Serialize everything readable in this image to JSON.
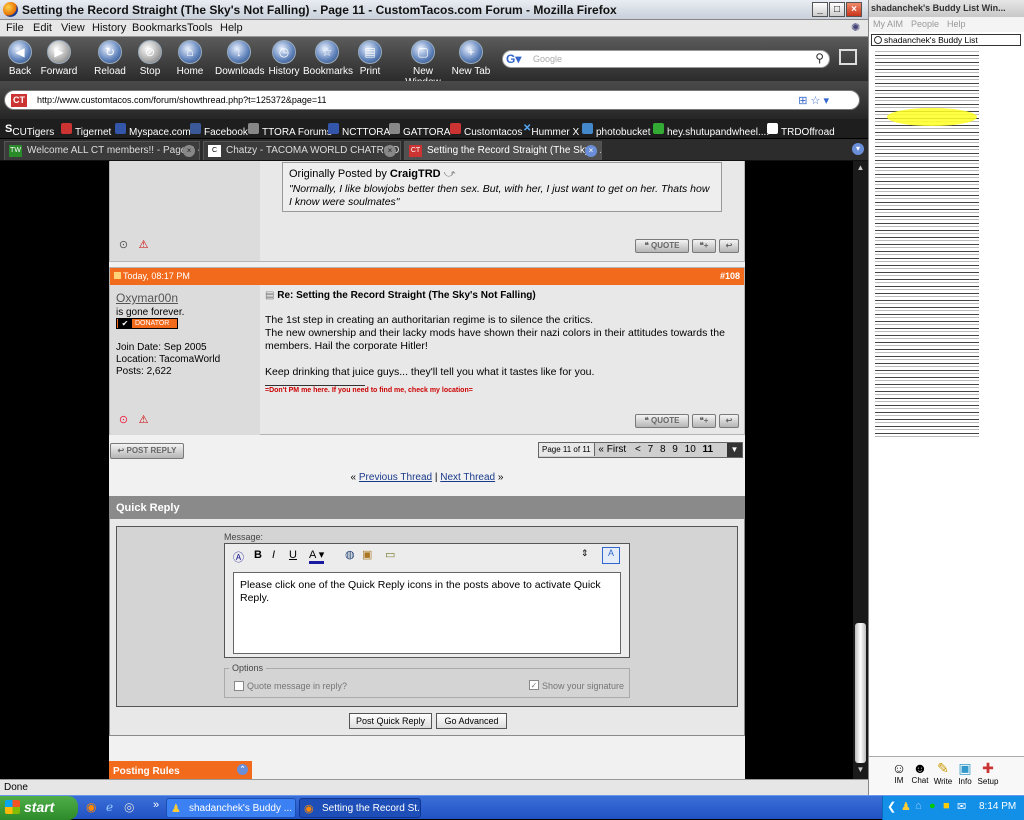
{
  "window": {
    "title": "Setting the Record Straight (The Sky's Not Falling) - Page 11 - CustomTacos.com Forum - Mozilla Firefox"
  },
  "menu": [
    "File",
    "Edit",
    "View",
    "History",
    "Bookmarks",
    "Tools",
    "Help"
  ],
  "toolbar": {
    "back": "Back",
    "forward": "Forward",
    "reload": "Reload",
    "stop": "Stop",
    "home": "Home",
    "downloads": "Downloads",
    "history": "History",
    "bookmarks": "Bookmarks",
    "print": "Print",
    "new_window": "New Window",
    "new_tab": "New Tab"
  },
  "search": {
    "placeholder": "Google"
  },
  "address": {
    "url": "http://www.customtacos.com/forum/showthread.php?t=125372&page=11"
  },
  "bookmarks": [
    "CUTigers",
    "Tigernet",
    "Myspace.com",
    "Facebook",
    "TTORA Forums",
    "NCTTORA",
    "GATTORA",
    "Customtacos",
    "Hummer X",
    "photobucket",
    "hey.shutupandwheel....",
    "TRDOffroad"
  ],
  "tabs": [
    {
      "label": "Welcome ALL CT members!! - Page 9 - ..."
    },
    {
      "label": "Chatzy - TACOMA WORLD CHATROOM"
    },
    {
      "label": "Setting the Record Straight (The Sky's ..."
    }
  ],
  "quote_post": {
    "originally_posted_by": "Originally Posted by",
    "author": "CraigTRD",
    "text": "\"Normally, I like blowjobs better then sex. But, with her, I just want to get on her. Thats how I know were soulmates\""
  },
  "post": {
    "date": "Today, 08:17 PM",
    "number": "#108",
    "username": "Oxymar00n",
    "user_title": "is gone forever.",
    "badge": "DONATOR",
    "join_date": "Join Date: Sep 2005",
    "location": "Location: TacomaWorld",
    "posts": "Posts: 2,622",
    "title": "Re: Setting the Record Straight (The Sky's Not Falling)",
    "body_line1": "The 1st step in creating an authoritarian regime is to silence the critics.",
    "body_line2": "The new ownership and their lacky mods have shown their nazi colors in their attitudes towards the members. Hail the corporate Hitler!",
    "body_line3": "Keep drinking that juice guys... they'll tell you what it tastes like for you.",
    "signature": "=Don't PM me here. If you need to find me, check my location="
  },
  "buttons": {
    "quote": "QUOTE",
    "post_reply": "POST REPLY"
  },
  "pagination": {
    "label": "Page 11 of 11",
    "first": "« First",
    "prev": "<",
    "pages": [
      "7",
      "8",
      "9",
      "10",
      "11"
    ]
  },
  "thread_nav": {
    "left": "«",
    "previous": "Previous Thread",
    "sep": "|",
    "next": "Next Thread",
    "right": "»"
  },
  "quick_reply": {
    "title": "Quick Reply",
    "message_label": "Message:",
    "textarea": "Please click one of the Quick Reply icons in the posts above to activate Quick Reply.",
    "options_label": "Options",
    "quote_message": "Quote message in reply?",
    "show_signature": "Show your signature",
    "post_button": "Post Quick Reply",
    "advanced_button": "Go Advanced"
  },
  "posting_rules": "Posting Rules",
  "status": "Done",
  "buddy": {
    "title": "shadanchek's Buddy List Win...",
    "menu": [
      "My AIM",
      "People",
      "Help"
    ],
    "tab": "shadanchek's Buddy List",
    "actions": [
      "IM",
      "Chat",
      "Write",
      "Info",
      "Setup"
    ]
  },
  "taskbar": {
    "start": "start",
    "buttons": [
      "shadanchek's Buddy ...",
      "Setting the Record St..."
    ],
    "clock": "8:14 PM"
  },
  "colors": {
    "accent": "#f26b1d",
    "header_gray": "#8a8a8a"
  }
}
